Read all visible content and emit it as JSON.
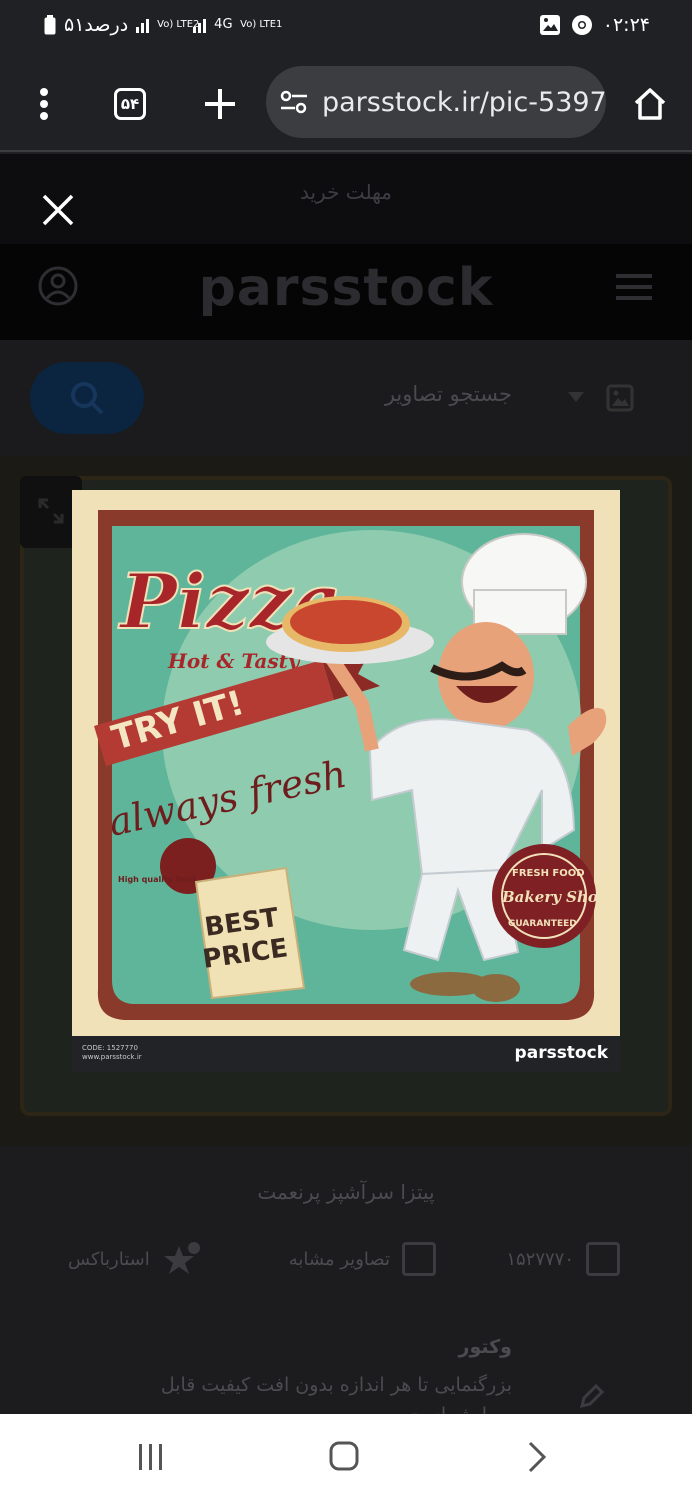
{
  "status": {
    "battery_text": "۵۱درصد",
    "net_sim2": "Vo) LTE2",
    "net_sim1_gen": "4G",
    "net_sim1": "Vo) LTE1",
    "time": "۰۲:۲۴"
  },
  "browser": {
    "tab_count": "۵۴",
    "url": "parsstock.ir/pic-5397",
    "icons": [
      "more-vert-icon",
      "tab-switcher-icon",
      "new-tab-icon",
      "site-settings-icon",
      "home-icon"
    ]
  },
  "page": {
    "promo_text": "مهلت خرید",
    "logo_text": "parsstock",
    "search_placeholder": "جستجو تصاویر",
    "image_title": "پیتزا سرآشپز پرنعمت",
    "image_id": "۱۵۲۷۷۷۰",
    "similar_label": "تصاویر مشابه",
    "extra_label": "استارباکس",
    "vector_title": "وکتور",
    "vector_desc": "بزرگنمایی تا هر اندازه بدون افت کیفیت قابل ویرایش است"
  },
  "preview": {
    "code_line": "CODE: 1527770",
    "site_line": "www.parsstock.ir",
    "brand": "parsstock",
    "poster": {
      "title": "Pizza",
      "subtitle": "Hot & Tasty",
      "banner": "TRY IT!",
      "tagline": "always fresh",
      "quality": "High quality food",
      "sign_line1": "BEST",
      "sign_line2": "PRICE",
      "stamp_top": "FRESH FOOD",
      "stamp_mid": "Bakery Shop",
      "stamp_bot": "GUARANTEED"
    }
  },
  "colors": {
    "poster_green": "#5fb59a",
    "poster_red": "#a8262a",
    "poster_cream": "#f3e4bf"
  }
}
